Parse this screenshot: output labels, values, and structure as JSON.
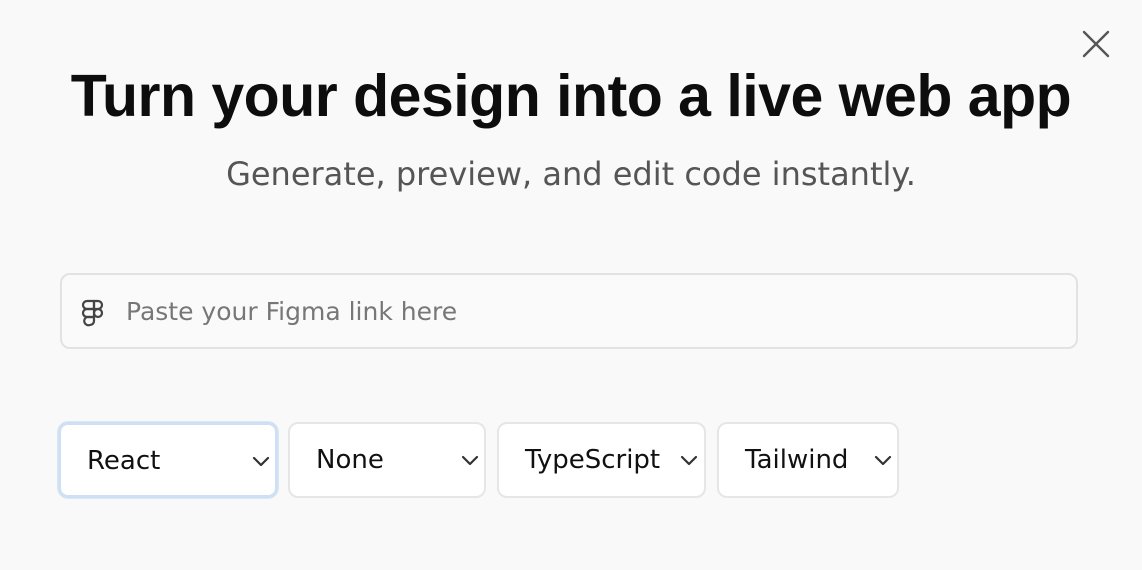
{
  "dialog": {
    "title": "Turn your design into a live web app",
    "subtitle": "Generate, preview, and edit code instantly.",
    "close_icon": "close-icon"
  },
  "figma_link": {
    "icon": "figma-icon",
    "placeholder": "Paste your Figma link here",
    "value": ""
  },
  "options": {
    "framework": {
      "selected": "React",
      "focused": true
    },
    "ui_library": {
      "selected": "None"
    },
    "language": {
      "selected": "TypeScript"
    },
    "styling": {
      "selected": "Tailwind"
    }
  },
  "colors": {
    "background": "#f9f9f9",
    "title_text": "#0d0d0d",
    "subtitle_text": "#555555",
    "border": "#e2e2e2",
    "focus_ring": "#cfe0f5"
  }
}
